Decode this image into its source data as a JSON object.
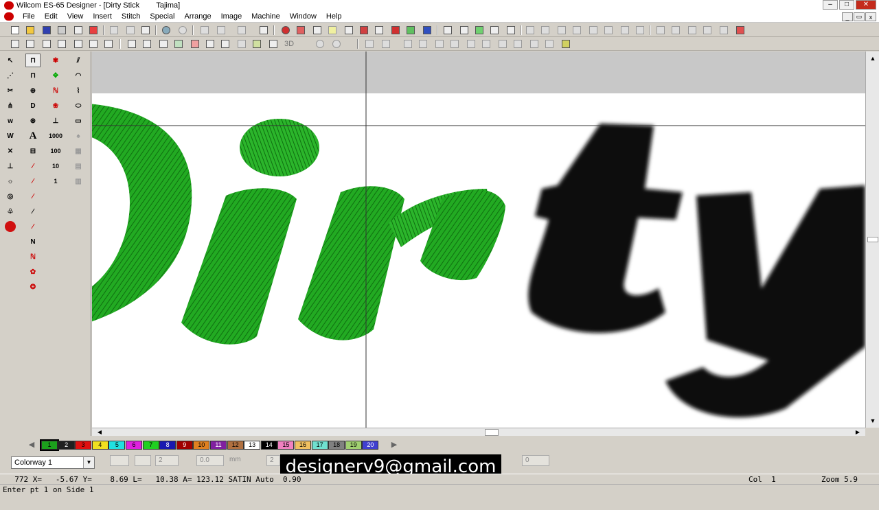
{
  "window": {
    "title": "Wilcom ES-65 Designer - [Dirty Stick        Tajima]",
    "minimize": "–",
    "maximize": "□",
    "close": "✕"
  },
  "menu": [
    "File",
    "Edit",
    "View",
    "Insert",
    "Stitch",
    "Special",
    "Arrange",
    "Image",
    "Machine",
    "Window",
    "Help"
  ],
  "mdi": {
    "min": "_",
    "restore": "▭",
    "close": "x"
  },
  "left_tools": {
    "text_tool": "A",
    "num_1000": "1000",
    "num_100": "100",
    "num_10": "10",
    "num_1": "1"
  },
  "toolbar2_label_3d": "3D",
  "palette": {
    "left_arrow": "◀",
    "right_arrow": "▶",
    "swatches": [
      {
        "label": "1",
        "color": "#1ca01c",
        "text": "#000"
      },
      {
        "label": "2",
        "color": "#202020",
        "text": "#fff"
      },
      {
        "label": "3",
        "color": "#e01010",
        "text": "#000"
      },
      {
        "label": "4",
        "color": "#f0e020",
        "text": "#000"
      },
      {
        "label": "5",
        "color": "#20e0e0",
        "text": "#000"
      },
      {
        "label": "6",
        "color": "#e020e0",
        "text": "#000"
      },
      {
        "label": "7",
        "color": "#20d020",
        "text": "#000"
      },
      {
        "label": "8",
        "color": "#1818b0",
        "text": "#fff"
      },
      {
        "label": "9",
        "color": "#a00000",
        "text": "#fff"
      },
      {
        "label": "10",
        "color": "#e08020",
        "text": "#000"
      },
      {
        "label": "11",
        "color": "#8020a0",
        "text": "#fff"
      },
      {
        "label": "12",
        "color": "#b07040",
        "text": "#000"
      },
      {
        "label": "13",
        "color": "#ffffff",
        "text": "#000"
      },
      {
        "label": "14",
        "color": "#000000",
        "text": "#fff"
      },
      {
        "label": "15",
        "color": "#f080c0",
        "text": "#000"
      },
      {
        "label": "16",
        "color": "#f0c060",
        "text": "#000"
      },
      {
        "label": "17",
        "color": "#70e0d0",
        "text": "#000"
      },
      {
        "label": "18",
        "color": "#808080",
        "text": "#000"
      },
      {
        "label": "19",
        "color": "#a0d070",
        "text": "#000"
      },
      {
        "label": "20",
        "color": "#4040d0",
        "text": "#fff"
      }
    ]
  },
  "bottombar": {
    "colorway": "Colorway 1",
    "field_a": "2",
    "field_b": "0.0",
    "field_b_unit": "mm",
    "field_c": "2",
    "field_d": "0"
  },
  "overlay_text": "designerv9@gmail.com",
  "status": {
    "line1": "  772 X=   -5.67 Y=    8.69 L=   10.38 A= 123.12 SATIN Auto  0.90",
    "col": "Col  1",
    "zoom": "Zoom 5.9",
    "line2": "Enter pt 1 on Side 1"
  },
  "colors": {
    "stitch_green": "#22aa22",
    "stitch_dark": "#0f6e10",
    "artwork_black": "#0a0a0a",
    "canvas_grey": "#c8c8c8"
  }
}
